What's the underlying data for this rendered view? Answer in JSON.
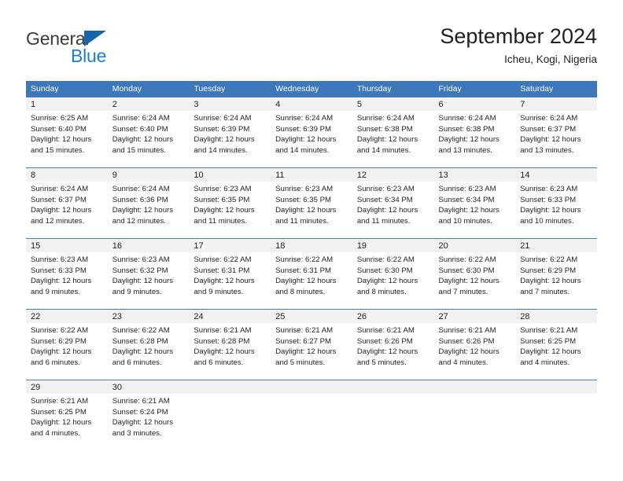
{
  "brand": {
    "name_part1": "General",
    "name_part2": "Blue",
    "triangle_icon": "triangle-icon",
    "accent_color": "#1664ab",
    "blue_text_color": "#1d7dd4"
  },
  "header": {
    "title": "September 2024",
    "subtitle": "Icheu, Kogi, Nigeria"
  },
  "calendar": {
    "header_background": "#3f77bb",
    "daynum_background": "#f2f2f2",
    "weekday_headers": [
      "Sunday",
      "Monday",
      "Tuesday",
      "Wednesday",
      "Thursday",
      "Friday",
      "Saturday"
    ],
    "weeks": [
      [
        {
          "day": "1",
          "sunrise": "Sunrise: 6:25 AM",
          "sunset": "Sunset: 6:40 PM",
          "daylight_line1": "Daylight: 12 hours",
          "daylight_line2": "and 15 minutes."
        },
        {
          "day": "2",
          "sunrise": "Sunrise: 6:24 AM",
          "sunset": "Sunset: 6:40 PM",
          "daylight_line1": "Daylight: 12 hours",
          "daylight_line2": "and 15 minutes."
        },
        {
          "day": "3",
          "sunrise": "Sunrise: 6:24 AM",
          "sunset": "Sunset: 6:39 PM",
          "daylight_line1": "Daylight: 12 hours",
          "daylight_line2": "and 14 minutes."
        },
        {
          "day": "4",
          "sunrise": "Sunrise: 6:24 AM",
          "sunset": "Sunset: 6:39 PM",
          "daylight_line1": "Daylight: 12 hours",
          "daylight_line2": "and 14 minutes."
        },
        {
          "day": "5",
          "sunrise": "Sunrise: 6:24 AM",
          "sunset": "Sunset: 6:38 PM",
          "daylight_line1": "Daylight: 12 hours",
          "daylight_line2": "and 14 minutes."
        },
        {
          "day": "6",
          "sunrise": "Sunrise: 6:24 AM",
          "sunset": "Sunset: 6:38 PM",
          "daylight_line1": "Daylight: 12 hours",
          "daylight_line2": "and 13 minutes."
        },
        {
          "day": "7",
          "sunrise": "Sunrise: 6:24 AM",
          "sunset": "Sunset: 6:37 PM",
          "daylight_line1": "Daylight: 12 hours",
          "daylight_line2": "and 13 minutes."
        }
      ],
      [
        {
          "day": "8",
          "sunrise": "Sunrise: 6:24 AM",
          "sunset": "Sunset: 6:37 PM",
          "daylight_line1": "Daylight: 12 hours",
          "daylight_line2": "and 12 minutes."
        },
        {
          "day": "9",
          "sunrise": "Sunrise: 6:24 AM",
          "sunset": "Sunset: 6:36 PM",
          "daylight_line1": "Daylight: 12 hours",
          "daylight_line2": "and 12 minutes."
        },
        {
          "day": "10",
          "sunrise": "Sunrise: 6:23 AM",
          "sunset": "Sunset: 6:35 PM",
          "daylight_line1": "Daylight: 12 hours",
          "daylight_line2": "and 11 minutes."
        },
        {
          "day": "11",
          "sunrise": "Sunrise: 6:23 AM",
          "sunset": "Sunset: 6:35 PM",
          "daylight_line1": "Daylight: 12 hours",
          "daylight_line2": "and 11 minutes."
        },
        {
          "day": "12",
          "sunrise": "Sunrise: 6:23 AM",
          "sunset": "Sunset: 6:34 PM",
          "daylight_line1": "Daylight: 12 hours",
          "daylight_line2": "and 11 minutes."
        },
        {
          "day": "13",
          "sunrise": "Sunrise: 6:23 AM",
          "sunset": "Sunset: 6:34 PM",
          "daylight_line1": "Daylight: 12 hours",
          "daylight_line2": "and 10 minutes."
        },
        {
          "day": "14",
          "sunrise": "Sunrise: 6:23 AM",
          "sunset": "Sunset: 6:33 PM",
          "daylight_line1": "Daylight: 12 hours",
          "daylight_line2": "and 10 minutes."
        }
      ],
      [
        {
          "day": "15",
          "sunrise": "Sunrise: 6:23 AM",
          "sunset": "Sunset: 6:33 PM",
          "daylight_line1": "Daylight: 12 hours",
          "daylight_line2": "and 9 minutes."
        },
        {
          "day": "16",
          "sunrise": "Sunrise: 6:23 AM",
          "sunset": "Sunset: 6:32 PM",
          "daylight_line1": "Daylight: 12 hours",
          "daylight_line2": "and 9 minutes."
        },
        {
          "day": "17",
          "sunrise": "Sunrise: 6:22 AM",
          "sunset": "Sunset: 6:31 PM",
          "daylight_line1": "Daylight: 12 hours",
          "daylight_line2": "and 9 minutes."
        },
        {
          "day": "18",
          "sunrise": "Sunrise: 6:22 AM",
          "sunset": "Sunset: 6:31 PM",
          "daylight_line1": "Daylight: 12 hours",
          "daylight_line2": "and 8 minutes."
        },
        {
          "day": "19",
          "sunrise": "Sunrise: 6:22 AM",
          "sunset": "Sunset: 6:30 PM",
          "daylight_line1": "Daylight: 12 hours",
          "daylight_line2": "and 8 minutes."
        },
        {
          "day": "20",
          "sunrise": "Sunrise: 6:22 AM",
          "sunset": "Sunset: 6:30 PM",
          "daylight_line1": "Daylight: 12 hours",
          "daylight_line2": "and 7 minutes."
        },
        {
          "day": "21",
          "sunrise": "Sunrise: 6:22 AM",
          "sunset": "Sunset: 6:29 PM",
          "daylight_line1": "Daylight: 12 hours",
          "daylight_line2": "and 7 minutes."
        }
      ],
      [
        {
          "day": "22",
          "sunrise": "Sunrise: 6:22 AM",
          "sunset": "Sunset: 6:29 PM",
          "daylight_line1": "Daylight: 12 hours",
          "daylight_line2": "and 6 minutes."
        },
        {
          "day": "23",
          "sunrise": "Sunrise: 6:22 AM",
          "sunset": "Sunset: 6:28 PM",
          "daylight_line1": "Daylight: 12 hours",
          "daylight_line2": "and 6 minutes."
        },
        {
          "day": "24",
          "sunrise": "Sunrise: 6:21 AM",
          "sunset": "Sunset: 6:28 PM",
          "daylight_line1": "Daylight: 12 hours",
          "daylight_line2": "and 6 minutes."
        },
        {
          "day": "25",
          "sunrise": "Sunrise: 6:21 AM",
          "sunset": "Sunset: 6:27 PM",
          "daylight_line1": "Daylight: 12 hours",
          "daylight_line2": "and 5 minutes."
        },
        {
          "day": "26",
          "sunrise": "Sunrise: 6:21 AM",
          "sunset": "Sunset: 6:26 PM",
          "daylight_line1": "Daylight: 12 hours",
          "daylight_line2": "and 5 minutes."
        },
        {
          "day": "27",
          "sunrise": "Sunrise: 6:21 AM",
          "sunset": "Sunset: 6:26 PM",
          "daylight_line1": "Daylight: 12 hours",
          "daylight_line2": "and 4 minutes."
        },
        {
          "day": "28",
          "sunrise": "Sunrise: 6:21 AM",
          "sunset": "Sunset: 6:25 PM",
          "daylight_line1": "Daylight: 12 hours",
          "daylight_line2": "and 4 minutes."
        }
      ],
      [
        {
          "day": "29",
          "sunrise": "Sunrise: 6:21 AM",
          "sunset": "Sunset: 6:25 PM",
          "daylight_line1": "Daylight: 12 hours",
          "daylight_line2": "and 4 minutes."
        },
        {
          "day": "30",
          "sunrise": "Sunrise: 6:21 AM",
          "sunset": "Sunset: 6:24 PM",
          "daylight_line1": "Daylight: 12 hours",
          "daylight_line2": "and 3 minutes."
        },
        {
          "day": "",
          "sunrise": "",
          "sunset": "",
          "daylight_line1": "",
          "daylight_line2": ""
        },
        {
          "day": "",
          "sunrise": "",
          "sunset": "",
          "daylight_line1": "",
          "daylight_line2": ""
        },
        {
          "day": "",
          "sunrise": "",
          "sunset": "",
          "daylight_line1": "",
          "daylight_line2": ""
        },
        {
          "day": "",
          "sunrise": "",
          "sunset": "",
          "daylight_line1": "",
          "daylight_line2": ""
        },
        {
          "day": "",
          "sunrise": "",
          "sunset": "",
          "daylight_line1": "",
          "daylight_line2": ""
        }
      ]
    ]
  }
}
